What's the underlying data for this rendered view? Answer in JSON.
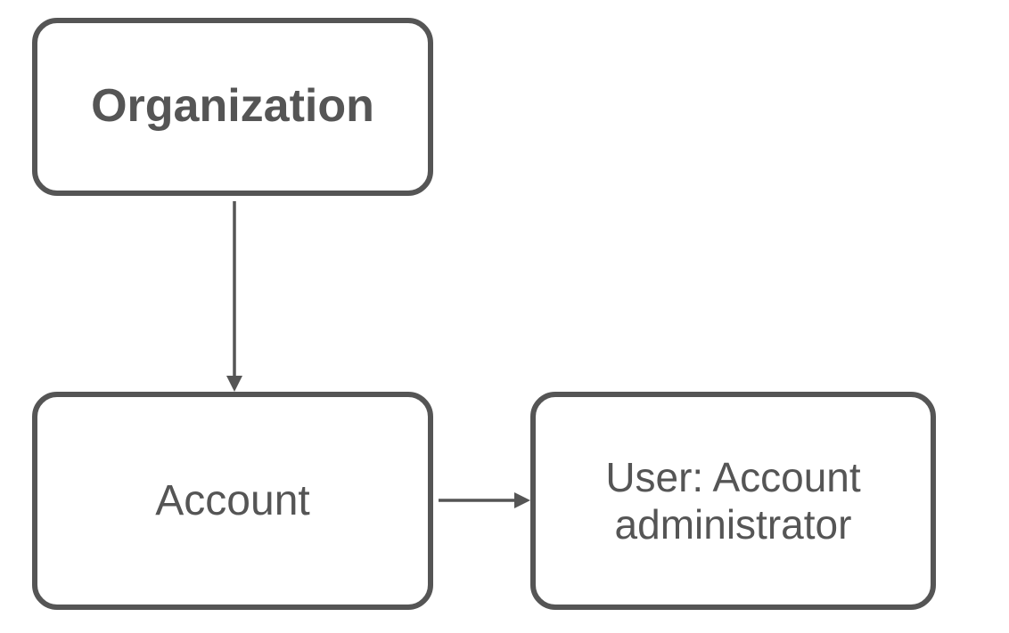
{
  "diagram": {
    "nodes": {
      "organization": {
        "label": "Organization"
      },
      "account": {
        "label": "Account"
      },
      "user": {
        "label_line1": "User: Account",
        "label_line2": "administrator"
      }
    },
    "edges": [
      {
        "from": "organization",
        "to": "account",
        "direction": "down"
      },
      {
        "from": "account",
        "to": "user",
        "direction": "right"
      }
    ]
  }
}
